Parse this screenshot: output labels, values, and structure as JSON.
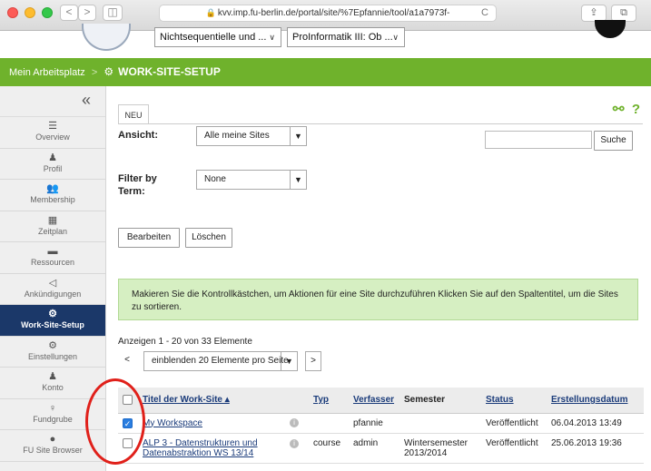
{
  "browser": {
    "address": "kvv.imp.fu-berlin.de/portal/site/%7Epfannie/tool/a1a7973f-",
    "back": "<",
    "forward": ">",
    "reload": "C"
  },
  "header": {
    "site_select_1": "Nichtsequentielle und ...",
    "site_select_2": "ProInformatik III: Ob ..."
  },
  "greenbar": {
    "home": "Mein Arbeitsplatz",
    "separator": ">",
    "tool": "WORK-SITE-SETUP"
  },
  "sidebar": {
    "collapse": "«",
    "items": [
      {
        "icon": "☰",
        "label": "Overview"
      },
      {
        "icon": "♟",
        "label": "Profil"
      },
      {
        "icon": "👥",
        "label": "Membership"
      },
      {
        "icon": "▦",
        "label": "Zeitplan"
      },
      {
        "icon": "▬",
        "label": "Ressourcen"
      },
      {
        "icon": "◁",
        "label": "Ankündigungen"
      },
      {
        "icon": "⚙",
        "label": "Work-Site-Setup"
      },
      {
        "icon": "⚙",
        "label": "Einstellungen"
      },
      {
        "icon": "♟",
        "label": "Konto"
      },
      {
        "icon": "♀",
        "label": "Fundgrube"
      },
      {
        "icon": "●",
        "label": "FU Site Browser"
      }
    ]
  },
  "main": {
    "tab_new": "NEU",
    "view_label": "Ansicht:",
    "view_value": "Alle meine Sites",
    "search_button": "Suche",
    "filter_label": "Filter by Term:",
    "filter_value": "None",
    "edit_button": "Bearbeiten",
    "delete_button": "Löschen",
    "info_text": "Makieren Sie die Kontrollkästchen, um Aktionen für eine Site durchzuführen Klicken Sie auf den Spaltentitel, um die Sites zu sortieren.",
    "paging_text": "Anzeigen 1 - 20 von 33 Elemente",
    "prev": "<",
    "next": ">",
    "page_size": "einblenden 20 Elemente pro Seite"
  },
  "table": {
    "headers": [
      "Titel der Work-Site ▴",
      "Typ",
      "Verfasser",
      "Semester",
      "Status",
      "Erstellungsdatum"
    ],
    "rows": [
      {
        "title": "My Workspace",
        "type": "",
        "author": "pfannie",
        "semester": "",
        "status": "Veröffentlicht",
        "created": "06.04.2013 13:49",
        "checked": true
      },
      {
        "title": "ALP 3 - Datenstrukturen und Datenabstraktion WS 13/14",
        "type": "course",
        "author": "admin",
        "semester": "Wintersemester 2013/2014",
        "status": "Veröffentlicht",
        "created": "25.06.2013 19:36",
        "checked": false
      }
    ]
  },
  "colors": {
    "green": "#6fb22c",
    "active_nav": "#1b3869",
    "info_bg": "#d6efc2"
  }
}
